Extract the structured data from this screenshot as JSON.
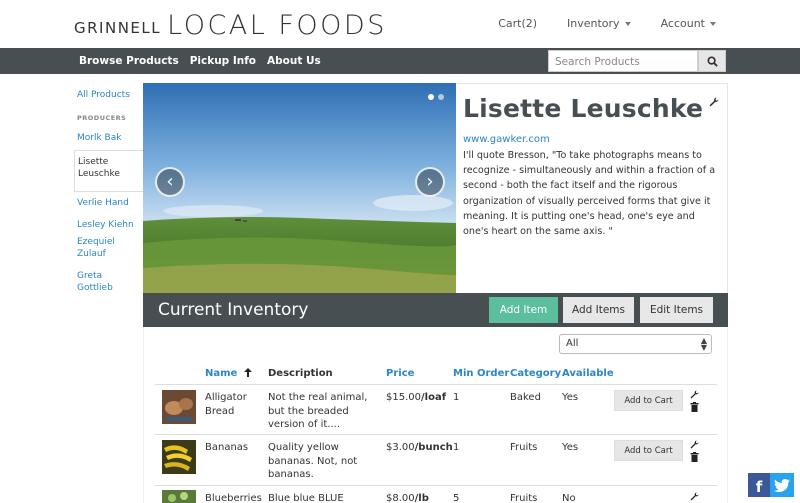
{
  "header": {
    "logo_small": "GRINNELL",
    "logo_big": "LOCAL FOODS",
    "cart_label": "Cart(2)",
    "inventory_label": "Inventory",
    "account_label": "Account"
  },
  "nav": {
    "browse_label": "Browse Products",
    "pickup_label": "Pickup Info",
    "about_label": "About Us",
    "search_placeholder": "Search Products"
  },
  "sidebar": {
    "all_products_label": "All Products",
    "producers_heading": "PRODUCERS",
    "producers": [
      "Morlk Bak",
      "Lisette Leuschke",
      "Verlie Hand",
      "Lesley Kiehn",
      "Ezequiel Zulauf",
      "Greta Gottlieb"
    ]
  },
  "producer": {
    "name": "Lisette Leuschke",
    "website": "www.gawker.com",
    "bio": "I'll quote Bresson, \"To take photographs means to recognize - simultaneously and within a fraction of a second - both the fact itself and the rigorous organization of visually perceived forms that give it meaning. It is putting one's head, one's eye and one's heart on the same axis. \""
  },
  "inventory": {
    "title": "Current Inventory",
    "add_item_label": "Add Item",
    "add_items_label": "Add Items",
    "edit_items_label": "Edit Items",
    "filter_value": "All",
    "columns": {
      "name": "Name",
      "description": "Description",
      "price": "Price",
      "min_order": "Min Order",
      "category": "Category",
      "available": "Available"
    },
    "add_to_cart_label": "Add to Cart",
    "rows": [
      {
        "name": "Alligator Bread",
        "description": "Not the real animal, but the breaded version of it....",
        "price": "$15.00",
        "unit": "/loaf",
        "min_order": "1",
        "category": "Baked",
        "available": "Yes"
      },
      {
        "name": "Bananas",
        "description": "Quality yellow bananas. Not, not bananas.",
        "price": "$3.00",
        "unit": "/bunch",
        "min_order": "1",
        "category": "Fruits",
        "available": "Yes"
      },
      {
        "name": "Blueberries",
        "description": "Blue blue BLUE",
        "price": "$8.00",
        "unit": "/lb",
        "min_order": "5",
        "category": "Fruits",
        "available": "No"
      }
    ]
  },
  "colors": {
    "nav_bg": "#474f53",
    "link": "#2a86c8",
    "add_item_bg": "#5bbf9e"
  }
}
